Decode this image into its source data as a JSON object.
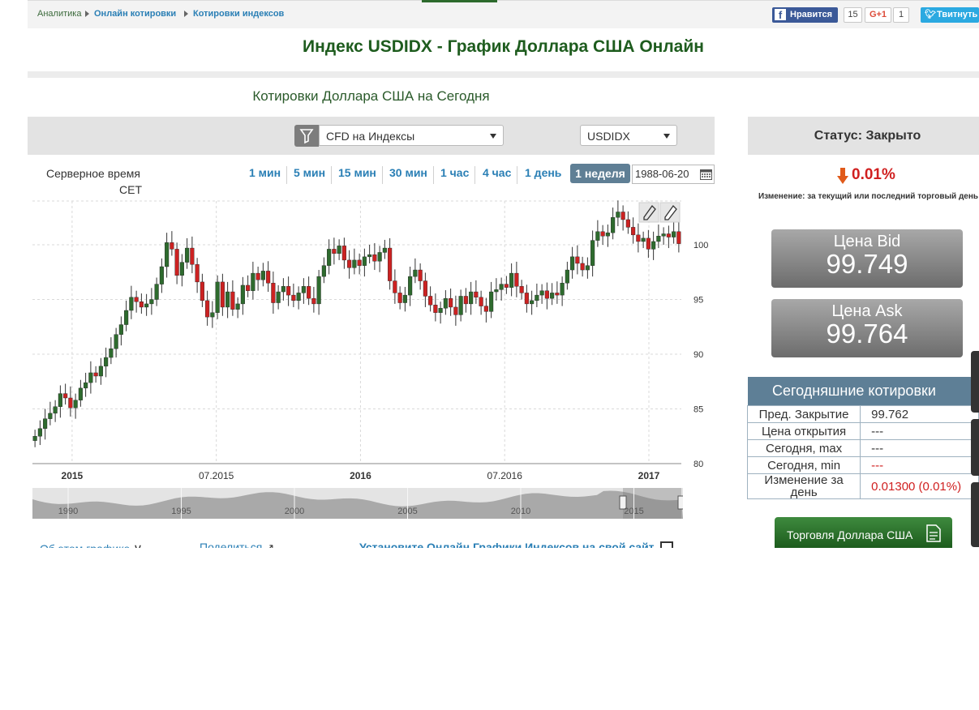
{
  "breadcrumb": {
    "items": [
      "Аналитика",
      "Онлайн котировки",
      "Котировки индексов"
    ]
  },
  "social": {
    "facebook_label": "Нравится",
    "facebook_count": "15",
    "gplus_label": "G+1",
    "gplus_count": "1",
    "twitter_label": "Твитнуть"
  },
  "page_title": "Индекс USDIDX - График Доллара США Онлайн",
  "subtitle": "Котировки Доллара США на Сегодня",
  "filters": {
    "category": "CFD на Индексы",
    "symbol": "USDIDX"
  },
  "server_time": {
    "label": "Серверное время",
    "zone": "CET"
  },
  "timeframes": [
    "1 мин",
    "5 мин",
    "15 мин",
    "30 мин",
    "1 час",
    "4 час",
    "1 день"
  ],
  "active_timeframe": "1 неделя",
  "date_value": "1988-06-20",
  "chart_data": {
    "type": "candlestick",
    "ylim": [
      80,
      104
    ],
    "y_ticks": [
      80,
      85,
      90,
      95,
      100
    ],
    "x_ticks": [
      "2015",
      "07.2015",
      "2016",
      "07.2016",
      "2017"
    ],
    "x_ticks_bold": [
      true,
      false,
      true,
      false,
      true
    ],
    "bull_color": "#2e6b2e",
    "bear_color": "#cc2222",
    "close_series_approx": [
      82.5,
      83.2,
      84.1,
      84.6,
      85.2,
      86.4,
      86.0,
      85.1,
      85.8,
      86.9,
      87.4,
      88.3,
      88.0,
      88.9,
      89.7,
      90.5,
      91.8,
      92.7,
      94.0,
      95.2,
      94.8,
      94.3,
      94.6,
      95.0,
      96.4,
      98.0,
      100.2,
      99.6,
      97.2,
      98.4,
      99.7,
      98.2,
      96.6,
      94.9,
      93.4,
      93.8,
      96.6,
      94.3,
      95.7,
      94.1,
      94.6,
      96.3,
      95.8,
      97.4,
      96.8,
      97.6,
      96.5,
      94.7,
      95.7,
      96.2,
      95.4,
      94.9,
      95.6,
      96.2,
      95.1,
      94.6,
      97.1,
      98.1,
      99.6,
      99.2,
      99.9,
      98.6,
      97.9,
      98.6,
      98.1,
      98.9,
      99.1,
      98.5,
      99.3,
      99.7,
      96.7,
      95.6,
      94.7,
      95.4,
      97.1,
      97.7,
      96.7,
      95.3,
      94.5,
      93.8,
      94.2,
      95.1,
      94.3,
      93.6,
      95.3,
      94.6,
      95.7,
      95.2,
      94.4,
      93.9,
      95.7,
      95.9,
      96.4,
      96.1,
      97.4,
      96.2,
      95.6,
      94.6,
      94.9,
      95.4,
      95.8,
      95.1,
      95.6,
      95.4,
      96.5,
      97.7,
      98.9,
      98.3,
      97.7,
      98.1,
      100.4,
      101.2,
      100.8,
      101.1,
      102.5,
      103.0,
      102.3,
      101.6,
      100.9,
      100.3,
      100.6,
      99.6,
      100.3,
      100.8,
      101.0,
      100.7,
      101.2,
      100.1
    ],
    "navigator_ticks": [
      "1990",
      "1995",
      "2000",
      "2005",
      "2010",
      "2015"
    ]
  },
  "footer_links": [
    "Об этом графике",
    "Поделиться",
    "Установите Онлайн Графики Индексов на свой сайт"
  ],
  "status": "Статус: Закрыто",
  "change": {
    "value": "0.01%",
    "note": "Изменение: за текущий или последний торговый день"
  },
  "bid": {
    "label": "Цена Bid",
    "value": "99.749"
  },
  "ask": {
    "label": "Цена Ask",
    "value": "99.764"
  },
  "quotes": {
    "title": "Сегодняшние котировки",
    "rows": [
      {
        "label": "Пред. Закрытие",
        "value": "99.762"
      },
      {
        "label": "Цена открытия",
        "value": "---"
      },
      {
        "label": "Сегодня, max",
        "value": "---"
      },
      {
        "label": "Сегодня, min",
        "value": "---"
      },
      {
        "label": "Изменение за день",
        "value": "0.01300 (0.01%)"
      }
    ]
  },
  "trade_button": "Торговля Доллара США",
  "colors": {
    "brand_green": "#1e5c1e",
    "link_blue": "#2a7fb5",
    "accent_red": "#d01f1f",
    "panel_blue": "#5e7f96"
  }
}
